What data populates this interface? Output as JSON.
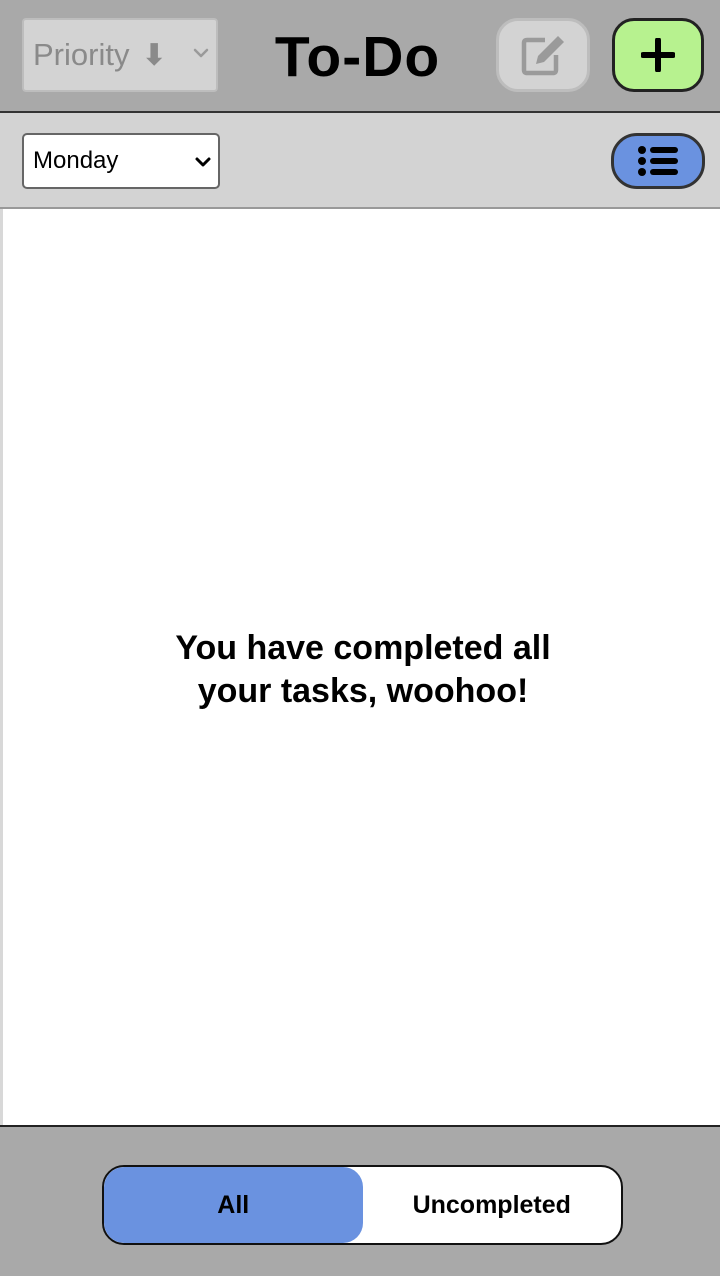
{
  "header": {
    "sort_select": {
      "label": "Priority",
      "arrow": "⬇"
    },
    "title": "To-Do",
    "edit_button_icon": "edit-icon",
    "add_button_icon": "plus-icon",
    "colors": {
      "bar": "#a9a9a9",
      "add": "#b7f28f",
      "disabled": "#d3d3d3"
    }
  },
  "toolbar": {
    "day_select": {
      "value": "Monday"
    },
    "view_toggle_icon": "list-icon",
    "colors": {
      "bar": "#d3d3d3",
      "accent": "#6a92e0"
    }
  },
  "main": {
    "empty_line1": "You have completed all",
    "empty_line2": "your tasks, woohoo!"
  },
  "footer": {
    "filters": [
      {
        "label": "All",
        "active": true
      },
      {
        "label": "Uncompleted",
        "active": false
      }
    ]
  }
}
